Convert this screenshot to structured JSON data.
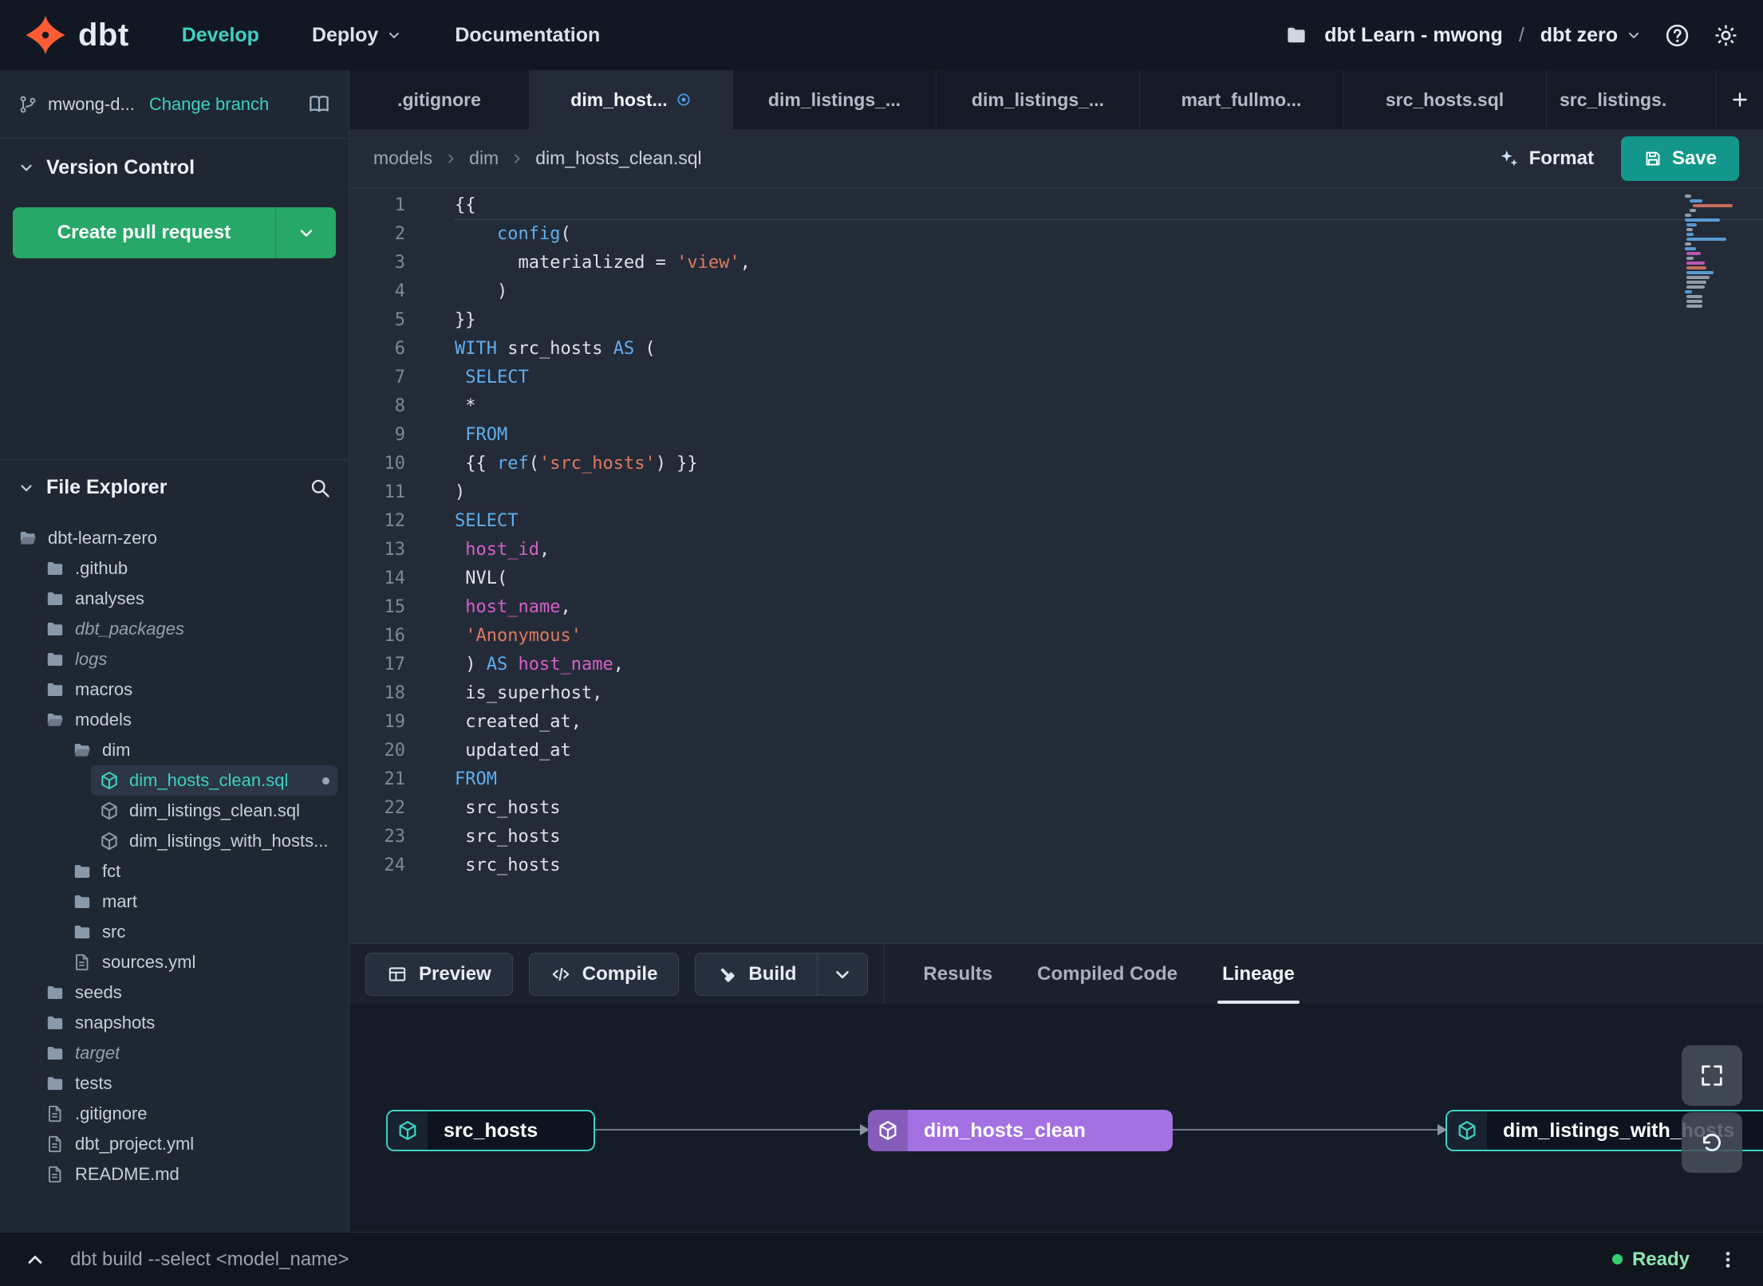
{
  "colors": {
    "brand": "#ff5c35",
    "accent": "#3dd1c2",
    "green": "#27a768",
    "purple": "#a471e3",
    "save": "#12978a",
    "ready": "#35d073"
  },
  "topnav": {
    "brand": "dbt",
    "develop": "Develop",
    "deploy": "Deploy",
    "documentation": "Documentation",
    "project": "dbt Learn - mwong",
    "separator": "/",
    "environment": "dbt zero"
  },
  "sidebar": {
    "branch_name": "mwong-d...",
    "change_branch": "Change branch",
    "version_control": "Version Control",
    "create_pull_request": "Create pull request",
    "file_explorer": "File Explorer",
    "tree": [
      {
        "label": "dbt-learn-zero",
        "type": "folder-open",
        "depth": 0
      },
      {
        "label": ".github",
        "type": "folder",
        "depth": 1
      },
      {
        "label": "analyses",
        "type": "folder",
        "depth": 1
      },
      {
        "label": "dbt_packages",
        "type": "folder",
        "depth": 1,
        "italic": true
      },
      {
        "label": "logs",
        "type": "folder",
        "depth": 1,
        "italic": true
      },
      {
        "label": "macros",
        "type": "folder",
        "depth": 1
      },
      {
        "label": "models",
        "type": "folder-open",
        "depth": 1
      },
      {
        "label": "dim",
        "type": "folder-open",
        "depth": 2
      },
      {
        "label": "dim_hosts_clean.sql",
        "type": "model",
        "depth": 3,
        "selected": true,
        "dirty": true
      },
      {
        "label": "dim_listings_clean.sql",
        "type": "model",
        "depth": 3
      },
      {
        "label": "dim_listings_with_hosts...",
        "type": "model",
        "depth": 3
      },
      {
        "label": "fct",
        "type": "folder",
        "depth": 2
      },
      {
        "label": "mart",
        "type": "folder",
        "depth": 2
      },
      {
        "label": "src",
        "type": "folder",
        "depth": 2
      },
      {
        "label": "sources.yml",
        "type": "file",
        "depth": 2
      },
      {
        "label": "seeds",
        "type": "folder",
        "depth": 1
      },
      {
        "label": "snapshots",
        "type": "folder",
        "depth": 1
      },
      {
        "label": "target",
        "type": "folder",
        "depth": 1,
        "italic": true
      },
      {
        "label": "tests",
        "type": "folder",
        "depth": 1
      },
      {
        "label": ".gitignore",
        "type": "file",
        "depth": 1
      },
      {
        "label": "dbt_project.yml",
        "type": "file",
        "depth": 1
      },
      {
        "label": "README.md",
        "type": "file",
        "depth": 1
      }
    ]
  },
  "tabs": {
    "items": [
      {
        "label": ".gitignore"
      },
      {
        "label": "dim_host...",
        "active": true,
        "dirty": true
      },
      {
        "label": "dim_listings_..."
      },
      {
        "label": "dim_listings_..."
      },
      {
        "label": "mart_fullmo..."
      },
      {
        "label": "src_hosts.sql"
      },
      {
        "label": "src_listings.",
        "fill": true
      }
    ]
  },
  "breadcrumb": {
    "parts": [
      "models",
      "dim",
      "dim_hosts_clean.sql"
    ],
    "format": "Format",
    "save": "Save"
  },
  "editor": {
    "lines": [
      {
        "n": 1,
        "t": [
          [
            "p",
            "{{"
          ]
        ]
      },
      {
        "n": 2,
        "t": [
          [
            "p",
            "    "
          ],
          [
            "fn",
            "config"
          ],
          [
            "p",
            "("
          ]
        ]
      },
      {
        "n": 3,
        "t": [
          [
            "p",
            "      materialized = "
          ],
          [
            "str",
            "'view'"
          ],
          [
            "p",
            ","
          ]
        ]
      },
      {
        "n": 4,
        "t": [
          [
            "p",
            "    )"
          ]
        ]
      },
      {
        "n": 5,
        "t": [
          [
            "p",
            "}}"
          ]
        ]
      },
      {
        "n": 6,
        "t": [
          [
            "kw",
            "WITH"
          ],
          [
            "p",
            " src_hosts "
          ],
          [
            "kw",
            "AS"
          ],
          [
            "p",
            " ("
          ]
        ]
      },
      {
        "n": 7,
        "t": [
          [
            "p",
            " "
          ],
          [
            "kw",
            "SELECT"
          ]
        ]
      },
      {
        "n": 8,
        "t": [
          [
            "p",
            " *"
          ]
        ]
      },
      {
        "n": 9,
        "t": [
          [
            "p",
            " "
          ],
          [
            "kw",
            "FROM"
          ]
        ]
      },
      {
        "n": 10,
        "t": [
          [
            "p",
            " {{ "
          ],
          [
            "fn",
            "ref"
          ],
          [
            "p",
            "("
          ],
          [
            "str",
            "'src_hosts'"
          ],
          [
            "p",
            ") }}"
          ]
        ]
      },
      {
        "n": 11,
        "t": [
          [
            "p",
            ")"
          ]
        ]
      },
      {
        "n": 12,
        "t": [
          [
            "kw",
            "SELECT"
          ]
        ]
      },
      {
        "n": 13,
        "t": [
          [
            "p",
            " "
          ],
          [
            "col",
            "host_id"
          ],
          [
            "p",
            ","
          ]
        ]
      },
      {
        "n": 14,
        "t": [
          [
            "p",
            " NVL("
          ]
        ]
      },
      {
        "n": 15,
        "t": [
          [
            "p",
            " "
          ],
          [
            "col",
            "host_name"
          ],
          [
            "p",
            ","
          ]
        ]
      },
      {
        "n": 16,
        "t": [
          [
            "p",
            " "
          ],
          [
            "str",
            "'Anonymous'"
          ]
        ]
      },
      {
        "n": 17,
        "t": [
          [
            "p",
            " ) "
          ],
          [
            "kw",
            "AS"
          ],
          [
            "p",
            " "
          ],
          [
            "col",
            "host_name"
          ],
          [
            "p",
            ","
          ]
        ]
      },
      {
        "n": 18,
        "t": [
          [
            "p",
            " is_superhost,"
          ]
        ]
      },
      {
        "n": 19,
        "t": [
          [
            "p",
            " created_at,"
          ]
        ]
      },
      {
        "n": 20,
        "t": [
          [
            "p",
            " updated_at"
          ]
        ]
      },
      {
        "n": 21,
        "t": [
          [
            "kw",
            "FROM"
          ]
        ]
      },
      {
        "n": 22,
        "t": [
          [
            "p",
            " src_hosts"
          ]
        ]
      },
      {
        "n": 23,
        "t": [
          [
            "p",
            " src_hosts"
          ]
        ]
      },
      {
        "n": 24,
        "t": [
          [
            "p",
            " src_hosts"
          ]
        ]
      }
    ]
  },
  "actionbar": {
    "preview": "Preview",
    "compile": "Compile",
    "build": "Build",
    "tabs": [
      "Results",
      "Compiled Code",
      "Lineage"
    ]
  },
  "lineage": {
    "nodes": [
      {
        "label": "src_hosts",
        "kind": "source"
      },
      {
        "label": "dim_hosts_clean",
        "kind": "model"
      },
      {
        "label": "dim_listings_with_hosts",
        "kind": "source"
      }
    ]
  },
  "statusbar": {
    "command": "dbt build --select <model_name>",
    "status": "Ready"
  }
}
